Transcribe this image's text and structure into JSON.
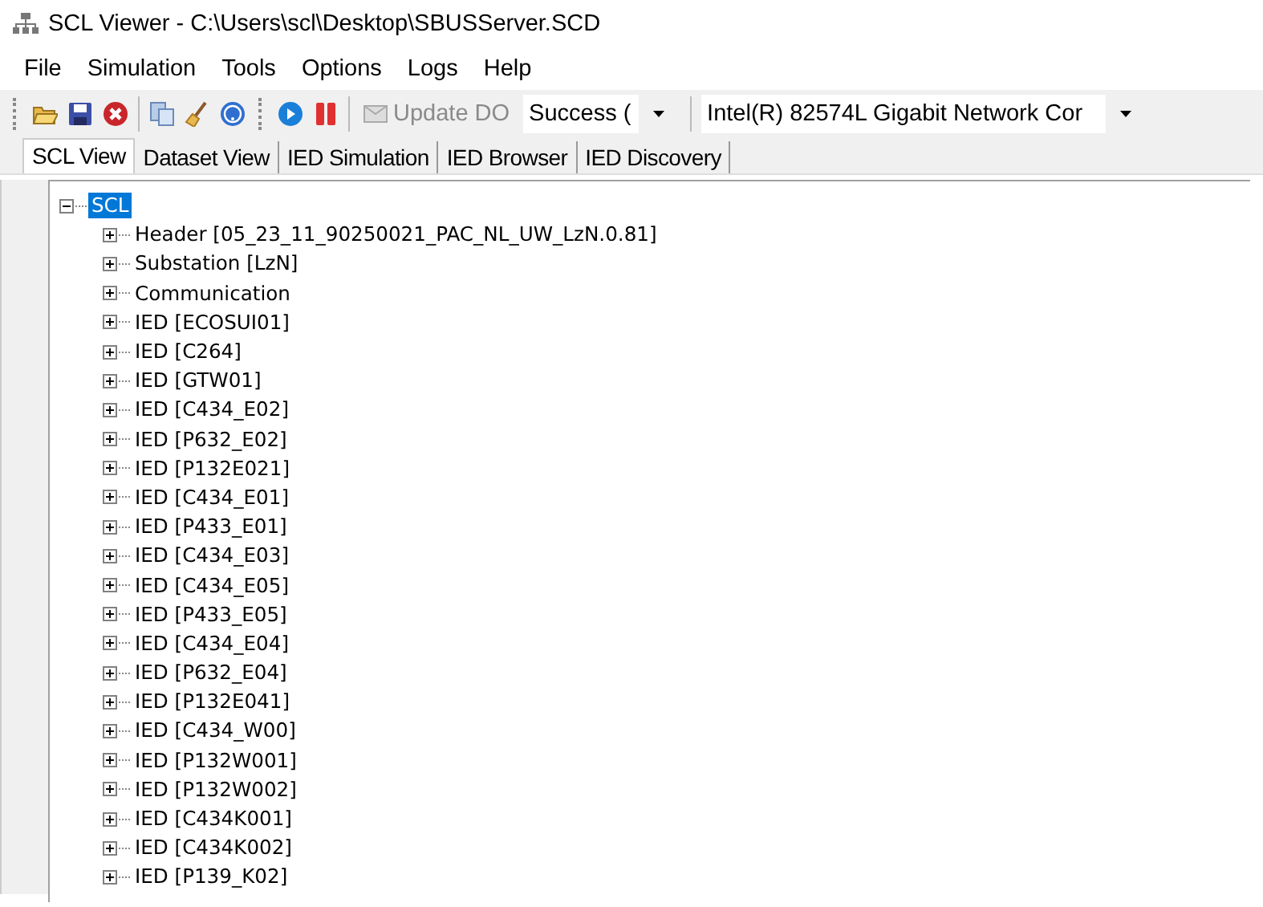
{
  "window": {
    "title": "SCL Viewer - C:\\Users\\scl\\Desktop\\SBUSServer.SCD"
  },
  "menu": [
    "File",
    "Simulation",
    "Tools",
    "Options",
    "Logs",
    "Help"
  ],
  "toolbar": {
    "update_button": {
      "label": "Update DO",
      "disabled": true
    },
    "status_combo": {
      "value": "Success ("
    },
    "adapter_combo": {
      "value": "Intel(R) 82574L Gigabit Network Cor"
    }
  },
  "tabs": [
    {
      "label": "SCL View",
      "selected": true
    },
    {
      "label": "Dataset View",
      "selected": false
    },
    {
      "label": "IED Simulation",
      "selected": false
    },
    {
      "label": "IED Browser",
      "selected": false
    },
    {
      "label": "IED Discovery",
      "selected": false
    }
  ],
  "tree": [
    {
      "label": "SCL",
      "expanded": true,
      "selected": true,
      "children": [
        {
          "label": "Header [05_23_11_90250021_PAC_NL_UW_LzN.0.81]",
          "expanded": false,
          "selected": false
        },
        {
          "label": "Substation [LzN]",
          "expanded": false,
          "selected": false
        },
        {
          "label": "Communication",
          "expanded": false,
          "selected": false
        },
        {
          "label": "IED [ECOSUI01]",
          "expanded": false,
          "selected": false
        },
        {
          "label": "IED [C264]",
          "expanded": false,
          "selected": false
        },
        {
          "label": "IED [GTW01]",
          "expanded": false,
          "selected": false
        },
        {
          "label": "IED [C434_E02]",
          "expanded": false,
          "selected": false
        },
        {
          "label": "IED [P632_E02]",
          "expanded": false,
          "selected": false
        },
        {
          "label": "IED [P132E021]",
          "expanded": false,
          "selected": false
        },
        {
          "label": "IED [C434_E01]",
          "expanded": false,
          "selected": false
        },
        {
          "label": "IED [P433_E01]",
          "expanded": false,
          "selected": false
        },
        {
          "label": "IED [C434_E03]",
          "expanded": false,
          "selected": false
        },
        {
          "label": "IED [C434_E05]",
          "expanded": false,
          "selected": false
        },
        {
          "label": "IED [P433_E05]",
          "expanded": false,
          "selected": false
        },
        {
          "label": "IED [C434_E04]",
          "expanded": false,
          "selected": false
        },
        {
          "label": "IED [P632_E04]",
          "expanded": false,
          "selected": false
        },
        {
          "label": "IED [P132E041]",
          "expanded": false,
          "selected": false
        },
        {
          "label": "IED [C434_W00]",
          "expanded": false,
          "selected": false
        },
        {
          "label": "IED [P132W001]",
          "expanded": false,
          "selected": false
        },
        {
          "label": "IED [P132W002]",
          "expanded": false,
          "selected": false
        },
        {
          "label": "IED [C434K001]",
          "expanded": false,
          "selected": false
        },
        {
          "label": "IED [C434K002]",
          "expanded": false,
          "selected": false
        },
        {
          "label": "IED [P139_K02]",
          "expanded": false,
          "selected": false
        }
      ]
    }
  ]
}
